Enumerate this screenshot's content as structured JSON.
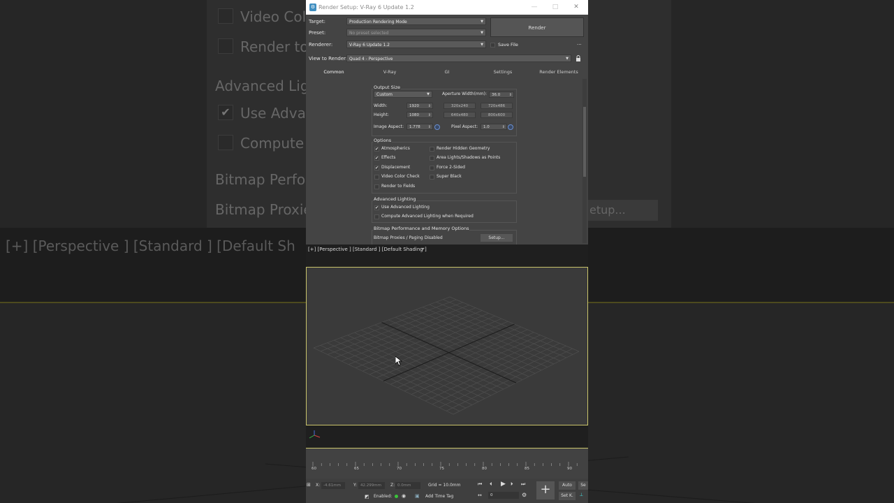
{
  "window": {
    "title": "Render Setup: V-Ray 6 Update 1.2",
    "minimize": "—",
    "maximize": "□",
    "close": "✕"
  },
  "setup": {
    "target_label": "Target:",
    "target_value": "Production Rendering Mode",
    "preset_label": "Preset:",
    "preset_value": "No preset selected",
    "renderer_label": "Renderer:",
    "renderer_value": "V-Ray 6 Update 1.2",
    "save_file_label": "Save File",
    "more": "...",
    "view_label": "View to Render:",
    "view_value": "Quad 4 - Perspective",
    "render_label": "Render"
  },
  "tabs": [
    "Common",
    "V-Ray",
    "GI",
    "Settings",
    "Render Elements"
  ],
  "output_size": {
    "title": "Output Size",
    "size_mode": "Custom",
    "aperture_label": "Aperture Width(mm):",
    "aperture_value": "36.0",
    "width_label": "Width:",
    "width_value": "1920",
    "height_label": "Height:",
    "height_value": "1080",
    "presets": [
      "320x240",
      "720x486",
      "640x480",
      "800x600"
    ],
    "image_aspect_label": "Image Aspect:",
    "image_aspect_value": "1.778",
    "pixel_aspect_label": "Pixel Aspect:",
    "pixel_aspect_value": "1.0"
  },
  "options": {
    "title": "Options",
    "items": [
      {
        "label": "Atmospherics",
        "checked": true
      },
      {
        "label": "Render Hidden Geometry",
        "checked": false
      },
      {
        "label": "Effects",
        "checked": true
      },
      {
        "label": "Area Lights/Shadows as Points",
        "checked": false
      },
      {
        "label": "Displacement",
        "checked": true
      },
      {
        "label": "Force 2-Sided",
        "checked": false
      },
      {
        "label": "Video Color Check",
        "checked": false
      },
      {
        "label": "Super Black",
        "checked": false
      },
      {
        "label": "Render to Fields",
        "checked": false
      }
    ]
  },
  "advanced_lighting": {
    "title": "Advanced Lighting",
    "use_label": "Use Advanced Lighting",
    "use_checked": true,
    "compute_label": "Compute Advanced Lighting when Required",
    "compute_checked": false
  },
  "bitmap": {
    "title": "Bitmap Performance and Memory Options",
    "status": "Bitmap Proxies / Paging Disabled",
    "setup_label": "Setup..."
  },
  "viewport": {
    "label": "[+] [Perspective ] [Standard ] [Default Shading ]",
    "filter_icon": "filter-icon"
  },
  "timeline": {
    "ticks": [
      "60",
      "65",
      "70",
      "75",
      "80",
      "85",
      "90"
    ]
  },
  "status": {
    "x_label": "X:",
    "x_value": "-4.61mm",
    "y_label": "Y:",
    "y_value": "42.299mm",
    "z_label": "Z:",
    "z_value": "0.0mm",
    "grid": "Grid = 10.0mm",
    "enabled_label": "Enabled:",
    "add_time_tag": "Add Time Tag",
    "frame_value": "0",
    "auto_label": "Auto",
    "setk_label": "Set K.",
    "se_label": "Se"
  },
  "background": {
    "line1": "Video Colo",
    "line2": "Render to",
    "adv": "Advanced Ligh",
    "use": "Use Adva",
    "compute": "Compute A",
    "bitmap1": "Bitmap Perfor",
    "bitmap2": "Bitmap Proxies",
    "setup": "etup...",
    "vptitle": "[+] [Perspective ] [Standard ] [Default Sh"
  }
}
